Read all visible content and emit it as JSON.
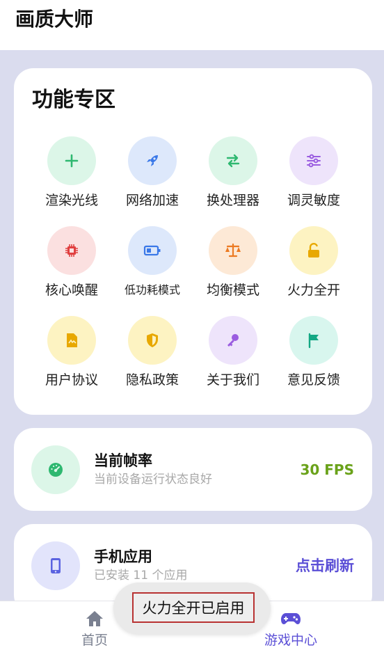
{
  "app": {
    "title": "画质大师"
  },
  "features": {
    "title": "功能专区",
    "items": [
      {
        "label": "渲染光线",
        "icon": "plus-icon",
        "bg": "#dcf6e8",
        "fg": "#2eb870"
      },
      {
        "label": "网络加速",
        "icon": "rocket-icon",
        "bg": "#dde8fb",
        "fg": "#3a78e8"
      },
      {
        "label": "换处理器",
        "icon": "swap-arrows-icon",
        "bg": "#dcf6e8",
        "fg": "#2eb870"
      },
      {
        "label": "调灵敏度",
        "icon": "sliders-icon",
        "bg": "#eee4fb",
        "fg": "#9a5ce0"
      },
      {
        "label": "核心唤醒",
        "icon": "cpu-chip-icon",
        "bg": "#fbe0e0",
        "fg": "#e04040"
      },
      {
        "label": "低功耗模式",
        "icon": "battery-icon",
        "bg": "#dde8fb",
        "fg": "#3a78e8"
      },
      {
        "label": "均衡模式",
        "icon": "scale-icon",
        "bg": "#fde9d6",
        "fg": "#ec7a22"
      },
      {
        "label": "火力全开",
        "icon": "unlock-icon",
        "bg": "#fdf3c2",
        "fg": "#e8a800"
      },
      {
        "label": "用户协议",
        "icon": "document-icon",
        "bg": "#fdf3c2",
        "fg": "#e8a800"
      },
      {
        "label": "隐私政策",
        "icon": "shield-icon",
        "bg": "#fdf3c2",
        "fg": "#e8a800"
      },
      {
        "label": "关于我们",
        "icon": "key-icon",
        "bg": "#eee4fb",
        "fg": "#9a5ce0"
      },
      {
        "label": "意见反馈",
        "icon": "flag-icon",
        "bg": "#d8f6ee",
        "fg": "#14a884"
      }
    ]
  },
  "fps_card": {
    "title": "当前帧率",
    "subtitle": "当前设备运行状态良好",
    "value": "30 FPS",
    "icon": "speedometer-icon",
    "value_color": "#6aa21a",
    "icon_bg": "#dcf6e8",
    "icon_fg": "#2eb870"
  },
  "apps_card": {
    "title": "手机应用",
    "subtitle": "已安装 11 个应用",
    "action": "点击刷新",
    "icon": "phone-icon",
    "action_color": "#5b4fd6",
    "icon_bg": "#e2e4fb",
    "icon_fg": "#5b63e0"
  },
  "nav": {
    "items": [
      {
        "label": "首页",
        "icon": "home-icon",
        "color": "#7a8090"
      },
      {
        "label": "游戏中心",
        "icon": "gamepad-icon",
        "color": "#5b4fd6"
      }
    ]
  },
  "toast": {
    "text": "火力全开已启用"
  }
}
